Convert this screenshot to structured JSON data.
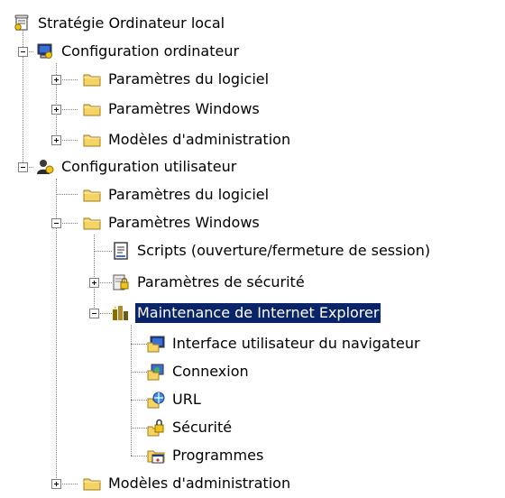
{
  "tree": {
    "root": {
      "label": "Stratégie Ordinateur local",
      "icon": "policy-scroll-icon"
    },
    "computer_config": {
      "label": "Configuration ordinateur",
      "icon": "computer-config-icon",
      "items": [
        {
          "label": "Paramètres du logiciel",
          "icon": "folder-icon"
        },
        {
          "label": "Paramètres Windows",
          "icon": "folder-icon"
        },
        {
          "label": "Modèles d'administration",
          "icon": "folder-icon"
        }
      ]
    },
    "user_config": {
      "label": "Configuration utilisateur",
      "icon": "user-config-icon",
      "software": {
        "label": "Paramètres du logiciel",
        "icon": "folder-icon"
      },
      "windows": {
        "label": "Paramètres Windows",
        "icon": "folder-icon",
        "scripts": {
          "label": "Scripts (ouverture/fermeture de session)",
          "icon": "script-icon"
        },
        "security": {
          "label": "Paramètres de sécurité",
          "icon": "security-settings-icon"
        },
        "ie_maintenance": {
          "label": "Maintenance de Internet Explorer",
          "icon": "ie-maintenance-icon",
          "items": [
            {
              "label": "Interface utilisateur du navigateur",
              "icon": "browser-ui-icon"
            },
            {
              "label": "Connexion",
              "icon": "connection-icon"
            },
            {
              "label": "URL",
              "icon": "url-icon"
            },
            {
              "label": "Sécurité",
              "icon": "security-icon"
            },
            {
              "label": "Programmes",
              "icon": "programs-icon"
            }
          ]
        }
      },
      "admin_templates": {
        "label": "Modèles d'administration",
        "icon": "folder-icon"
      }
    }
  },
  "colors": {
    "selection_bg": "#0a246a",
    "selection_text": "#ffffff",
    "folder": "#f6d365"
  }
}
